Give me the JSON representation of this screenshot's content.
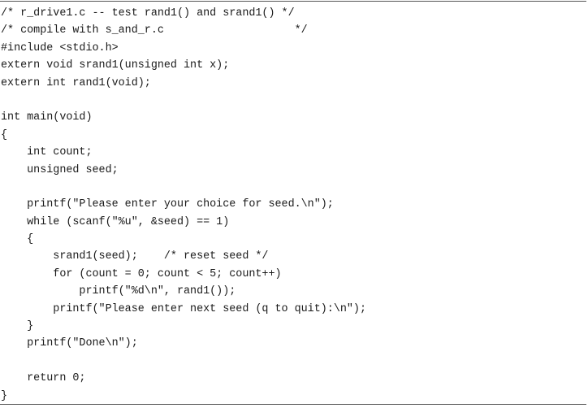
{
  "code": {
    "lines": [
      "/* r_drive1.c -- test rand1() and srand1() */",
      "/* compile with s_and_r.c                    */",
      "#include <stdio.h>",
      "extern void srand1(unsigned int x);",
      "extern int rand1(void);",
      "",
      "int main(void)",
      "{",
      "    int count;",
      "    unsigned seed;",
      "",
      "    printf(\"Please enter your choice for seed.\\n\");",
      "    while (scanf(\"%u\", &seed) == 1)",
      "    {",
      "        srand1(seed);    /* reset seed */",
      "        for (count = 0; count < 5; count++)",
      "            printf(\"%d\\n\", rand1());",
      "        printf(\"Please enter next seed (q to quit):\\n\");",
      "    }",
      "    printf(\"Done\\n\");",
      "",
      "    return 0;",
      "}"
    ]
  }
}
